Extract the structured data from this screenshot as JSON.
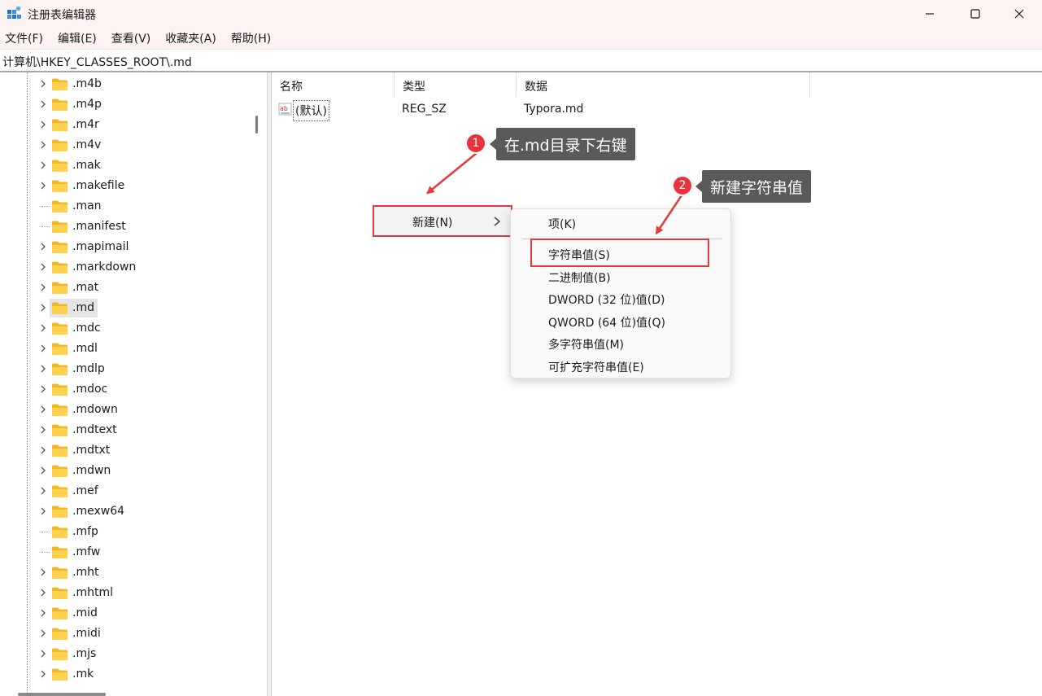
{
  "window": {
    "title": "注册表编辑器",
    "app_icon": "regedit-icon",
    "controls": [
      "minimize-icon",
      "maximize-icon",
      "close-icon"
    ]
  },
  "menubar": {
    "items": [
      "文件(F)",
      "编辑(E)",
      "查看(V)",
      "收藏夹(A)",
      "帮助(H)"
    ]
  },
  "address": {
    "path": "计算机\\HKEY_CLASSES_ROOT\\.md"
  },
  "tree": {
    "selected": ".md",
    "items": [
      {
        "label": ".m4b",
        "expandable": true
      },
      {
        "label": ".m4p",
        "expandable": true
      },
      {
        "label": ".m4r",
        "expandable": true
      },
      {
        "label": ".m4v",
        "expandable": true
      },
      {
        "label": ".mak",
        "expandable": true
      },
      {
        "label": ".makefile",
        "expandable": true
      },
      {
        "label": ".man",
        "expandable": false
      },
      {
        "label": ".manifest",
        "expandable": false
      },
      {
        "label": ".mapimail",
        "expandable": true
      },
      {
        "label": ".markdown",
        "expandable": true
      },
      {
        "label": ".mat",
        "expandable": true
      },
      {
        "label": ".md",
        "expandable": true
      },
      {
        "label": ".mdc",
        "expandable": true
      },
      {
        "label": ".mdl",
        "expandable": true
      },
      {
        "label": ".mdlp",
        "expandable": true
      },
      {
        "label": ".mdoc",
        "expandable": true
      },
      {
        "label": ".mdown",
        "expandable": true
      },
      {
        "label": ".mdtext",
        "expandable": true
      },
      {
        "label": ".mdtxt",
        "expandable": true
      },
      {
        "label": ".mdwn",
        "expandable": true
      },
      {
        "label": ".mef",
        "expandable": true
      },
      {
        "label": ".mexw64",
        "expandable": true
      },
      {
        "label": ".mfp",
        "expandable": false
      },
      {
        "label": ".mfw",
        "expandable": false
      },
      {
        "label": ".mht",
        "expandable": true
      },
      {
        "label": ".mhtml",
        "expandable": true
      },
      {
        "label": ".mid",
        "expandable": true
      },
      {
        "label": ".midi",
        "expandable": true
      },
      {
        "label": ".mjs",
        "expandable": true
      },
      {
        "label": ".mk",
        "expandable": true
      }
    ]
  },
  "values": {
    "columns": {
      "name": "名称",
      "type": "类型",
      "data": "数据"
    },
    "rows": [
      {
        "name": "(默认)",
        "type": "REG_SZ",
        "data": "Typora.md",
        "icon": "string-value-icon"
      }
    ]
  },
  "context_menu": {
    "new_label": "新建(N)",
    "submenu": {
      "key": "项(K)",
      "string": "字符串值(S)",
      "binary": "二进制值(B)",
      "dword": "DWORD (32 位)值(D)",
      "qword": "QWORD (64 位)值(Q)",
      "multi_string": "多字符串值(M)",
      "expand_string": "可扩充字符串值(E)"
    }
  },
  "annotations": {
    "step1": {
      "number": "1",
      "text": "在.md目录下右键"
    },
    "step2": {
      "number": "2",
      "text": "新建字符串值"
    },
    "accent_color": "#e23b3b"
  }
}
